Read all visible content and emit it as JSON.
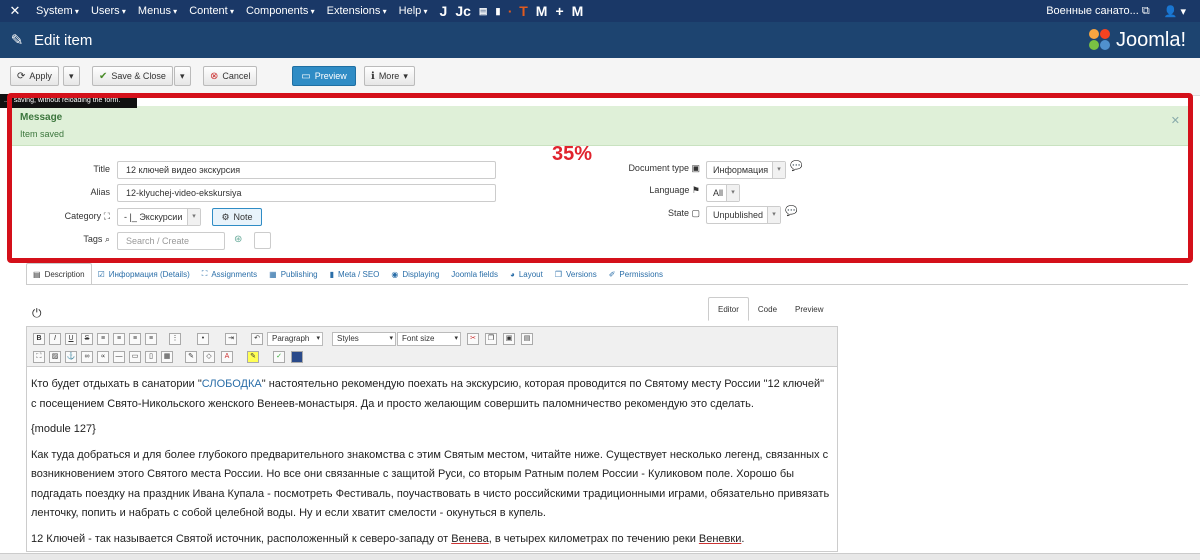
{
  "topbar": {
    "menu": [
      "System",
      "Users",
      "Menus",
      "Content",
      "Components",
      "Extensions",
      "Help"
    ],
    "site_name": "Военные санато...",
    "user_icon": "user-icon"
  },
  "header": {
    "title": "Edit item",
    "brand": "Joomla!"
  },
  "toolbar": {
    "apply": "Apply",
    "save_close": "Save & Close",
    "cancel": "Cancel",
    "preview": "Preview",
    "more": "More"
  },
  "tooltip": "...t saving, without reloading the form.",
  "message": {
    "heading": "Message",
    "body": "Item saved"
  },
  "annotation": "35%",
  "form": {
    "title_label": "Title",
    "title_value": "12 ключей видео экскурсия",
    "alias_label": "Alias",
    "alias_value": "12-klyuchej-video-ekskursiya",
    "category_label": "Category",
    "category_value": "- |_ Экскурсии",
    "note_label": "Note",
    "tags_label": "Tags",
    "tags_placeholder": "Search / Create",
    "doctype_label": "Document type",
    "doctype_value": "Информация",
    "language_label": "Language",
    "language_value": "All",
    "state_label": "State",
    "state_value": "Unpublished"
  },
  "tabs": [
    "Description",
    "Информация (Details)",
    "Assignments",
    "Publishing",
    "Meta / SEO",
    "Displaying",
    "Joomla fields",
    "Layout",
    "Versions",
    "Permissions"
  ],
  "editor_tabs": [
    "Editor",
    "Code",
    "Preview"
  ],
  "editor_toolbar": {
    "format": "Paragraph",
    "styles": "Styles",
    "font_size": "Font size"
  },
  "content": {
    "p1_pre": "Кто будет отдыхать в санатории \"",
    "p1_link": "СЛОБОДКА",
    "p1_post": "\"  настоятельно рекомендую поехать на экскурсию, которая проводится по Святому месту России \"12 ключей\" с посещением Свято-Никольского женского Венеев-монастыря. Да и просто желающим совершить паломничество рекомендую это сделать.",
    "p2": "{module 127}",
    "p3": "Как туда добраться и для более глубокого предварительного знакомства с этим Святым местом, читайте ниже. Существует несколько легенд, связанных с возникновением этого Святого места России. Но все они связанные с защитой Руси, со вторым Ратным полем России - Куликовом поле. Хорошо бы подгадать поездку на праздник Ивана Купала - посмотреть Фестиваль, поучаствовать в чисто российскими традиционными играми, обязательно привязать ленточку, попить и набрать с собой целебной воды. Ну и если хватит смелости - окунуться в купель.",
    "p4_pre": "12 Ключей - так называется Святой источник, расположенный к северо-западу от ",
    "p4_u1": "Венева",
    "p4_mid": ", в четырех километрах по течению реки ",
    "p4_u2": "Веневки",
    "p4_post": "."
  },
  "colors": {
    "topbar": "#1a3867",
    "header": "#1d4470",
    "highlight": "#d4101a",
    "success_bg": "#dff0d8",
    "link": "#2a6ea8"
  }
}
